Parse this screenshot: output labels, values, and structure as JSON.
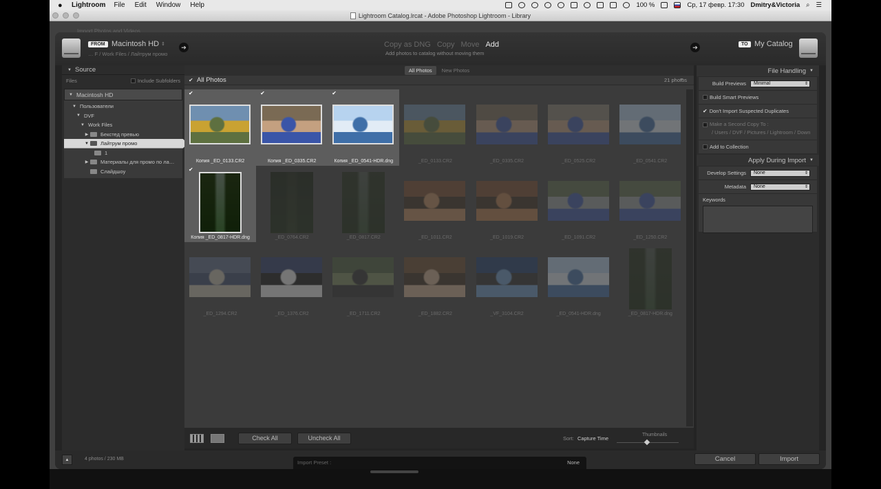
{
  "menubar": {
    "app": "Lightroom",
    "items": [
      "File",
      "Edit",
      "Window",
      "Help"
    ],
    "battery": "100 %",
    "clock": "Ср, 17 февр.  17:30",
    "user": "Dmitry&Victoria"
  },
  "window": {
    "title": "Lightroom Catalog.lrcat - Adobe Photoshop Lightroom - Library"
  },
  "background": {
    "ghost_text": "Import Photos and Videos"
  },
  "header": {
    "from_badge": "FROM",
    "source_name": "Macintosh HD",
    "source_path": "… F / Work Files / Лайтрум промо",
    "modes": [
      "Copy as DNG",
      "Copy",
      "Move",
      "Add"
    ],
    "active_mode": "Add",
    "mode_description": "Add photos to catalog without moving them",
    "to_badge": "TO",
    "catalog_name": "My Catalog"
  },
  "source_panel": {
    "title": "Source",
    "files_label": "Files",
    "include_subfolders": "Include Subfolders",
    "tree": [
      {
        "label": "Macintosh HD",
        "level": 0,
        "top": true,
        "tri": "▼"
      },
      {
        "label": "Пользователи",
        "level": 1,
        "tri": "▼"
      },
      {
        "label": "DVF",
        "level": 2,
        "tri": "▼"
      },
      {
        "label": "Work Files",
        "level": 3,
        "tri": "▼"
      },
      {
        "label": "Бекстед превью",
        "level": 4,
        "tri": "▶",
        "folder": true
      },
      {
        "label": "Лайтрум промо",
        "level": 4,
        "tri": "▼",
        "folder": true,
        "selected": true
      },
      {
        "label": "1",
        "level": 5,
        "folder": true
      },
      {
        "label": "Материалы для промо по ла…",
        "level": 4,
        "tri": "▶",
        "folder": true
      },
      {
        "label": "Слайдшоу",
        "level": 4,
        "folder": true
      }
    ]
  },
  "grid": {
    "filters": [
      "All Photos",
      "New Photos"
    ],
    "active_filter": "All Photos",
    "title": "All Photos",
    "count": "21 photos",
    "photos": [
      {
        "name": "Копия _ED_0133.CR2",
        "checked": true,
        "orientation": "landscape",
        "colors": [
          "#6f8fb0",
          "#5e7040",
          "#c9a232"
        ]
      },
      {
        "name": "Копия _ED_0335.CR2",
        "checked": true,
        "orientation": "landscape",
        "colors": [
          "#7a6a54",
          "#3a55a8",
          "#c4a080"
        ]
      },
      {
        "name": "Копия _ED_0541-HDR.dng",
        "checked": true,
        "orientation": "landscape",
        "colors": [
          "#b7d3ef",
          "#3f6fa8",
          "#e2ecf6"
        ]
      },
      {
        "name": "_ED_0133.CR2",
        "checked": false,
        "orientation": "landscape",
        "colors": [
          "#6f8fb0",
          "#5e7040",
          "#c9a232"
        ]
      },
      {
        "name": "_ED_0335.CR2",
        "checked": false,
        "orientation": "landscape",
        "colors": [
          "#7a6a54",
          "#3a55a8",
          "#c4a080"
        ]
      },
      {
        "name": "_ED_0525.CR2",
        "checked": false,
        "orientation": "landscape",
        "colors": [
          "#8a8070",
          "#3a55a8",
          "#c4a080"
        ]
      },
      {
        "name": "_ED_0541.CR2",
        "checked": false,
        "orientation": "landscape",
        "colors": [
          "#b7d3ef",
          "#3f6fa8",
          "#e2ecf6"
        ]
      },
      {
        "name": "Копия _ED_0817-HDR.dng",
        "checked": true,
        "orientation": "portrait",
        "colors": [
          "#3f5a2e",
          "#a9c0c8",
          "#6a6a5a"
        ]
      },
      {
        "name": "_ED_0764.CR2",
        "checked": false,
        "orientation": "portrait",
        "colors": [
          "#3f5a2e",
          "#6f7a5a",
          "#2a3a20"
        ]
      },
      {
        "name": "_ED_0817.CR2",
        "checked": false,
        "orientation": "portrait",
        "colors": [
          "#3f5a2e",
          "#a9c0c8",
          "#6a6a5a"
        ]
      },
      {
        "name": "_ED_1011.CR2",
        "checked": false,
        "orientation": "landscape",
        "colors": [
          "#7a4a2a",
          "#c08a5a",
          "#3a2a1a"
        ]
      },
      {
        "name": "_ED_1019.CR2",
        "checked": false,
        "orientation": "landscape",
        "colors": [
          "#7a4a2a",
          "#b87a4a",
          "#3a2a1a"
        ]
      },
      {
        "name": "_ED_1091.CR2",
        "checked": false,
        "orientation": "landscape",
        "colors": [
          "#5a6a4a",
          "#3a55a8",
          "#9aa0a0"
        ]
      },
      {
        "name": "_ED_1250.CR2",
        "checked": false,
        "orientation": "landscape",
        "colors": [
          "#5a6a4a",
          "#3a55a8",
          "#9aa0a0"
        ]
      },
      {
        "name": "_ED_1294.CR2",
        "checked": false,
        "orientation": "landscape",
        "colors": [
          "#5a6a8a",
          "#c8c0b0",
          "#3a4a6a"
        ]
      },
      {
        "name": "_ED_1376.CR2",
        "checked": false,
        "orientation": "landscape",
        "colors": [
          "#2a3a6a",
          "#eeeeee",
          "#111111"
        ]
      },
      {
        "name": "_ED_1711.CR2",
        "checked": false,
        "orientation": "landscape",
        "colors": [
          "#4a5a3a",
          "#2a2a2a",
          "#7a8a5a"
        ]
      },
      {
        "name": "_ED_1882.CR2",
        "checked": false,
        "orientation": "landscape",
        "colors": [
          "#6a4a2a",
          "#d0b090",
          "#3a2a1a"
        ]
      },
      {
        "name": "_VF_3104.CR2",
        "checked": false,
        "orientation": "landscape",
        "colors": [
          "#1a3a6a",
          "#6a9acb",
          "#2a2a2a"
        ]
      },
      {
        "name": "_ED_0541-HDR.dng",
        "checked": false,
        "orientation": "landscape",
        "colors": [
          "#b7d3ef",
          "#3f6fa8",
          "#e2ecf6"
        ]
      },
      {
        "name": "_ED_0817-HDR.dng",
        "checked": false,
        "orientation": "portrait",
        "colors": [
          "#3f5a2e",
          "#a9c0c8",
          "#6a6a5a"
        ]
      }
    ]
  },
  "toolbar": {
    "check_all": "Check All",
    "uncheck_all": "Uncheck All",
    "sort_label": "Sort:",
    "sort_value": "Capture Time",
    "thumbnails_label": "Thumbnails"
  },
  "file_handling": {
    "title": "File Handling",
    "build_previews_label": "Build Previews",
    "build_previews_value": "Minimal",
    "smart_previews": "Build Smart Previews",
    "no_duplicates": "Don't Import Suspected Duplicates",
    "second_copy": "Make a Second Copy To :",
    "second_copy_path": "/ Users / DVF / Pictures / Lightroom / Down",
    "add_to_collection": "Add to Collection"
  },
  "apply_during_import": {
    "title": "Apply During Import",
    "develop_label": "Develop Settings",
    "develop_value": "None",
    "metadata_label": "Metadata",
    "metadata_value": "None",
    "keywords_label": "Keywords"
  },
  "footer": {
    "info": "4 photos / 230 MB",
    "preset_label": "Import Preset :",
    "preset_value": "None",
    "cancel": "Cancel",
    "import": "Import"
  }
}
